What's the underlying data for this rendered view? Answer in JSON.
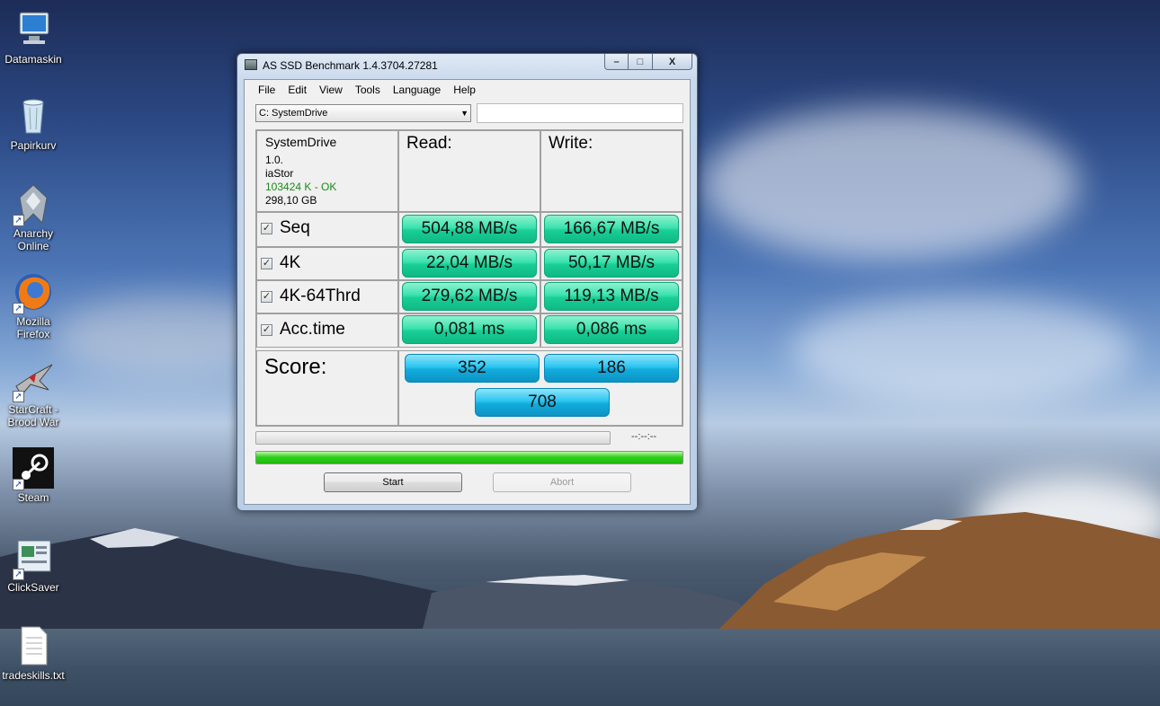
{
  "desktop": {
    "icons": [
      {
        "label": "Datamaskin",
        "icon": "computer-icon",
        "shortcut": false
      },
      {
        "label": "Papirkurv",
        "icon": "recycle-bin-icon",
        "shortcut": false
      },
      {
        "label": "Anarchy Online",
        "icon": "anarchy-online-icon",
        "shortcut": true
      },
      {
        "label": "Mozilla Firefox",
        "icon": "firefox-icon",
        "shortcut": true
      },
      {
        "label": "StarCraft - Brood War",
        "icon": "starcraft-icon",
        "shortcut": true
      },
      {
        "label": "Steam",
        "icon": "steam-icon",
        "shortcut": true
      },
      {
        "label": "ClickSaver",
        "icon": "clicksaver-icon",
        "shortcut": true
      },
      {
        "label": "tradeskills.txt",
        "icon": "text-file-icon",
        "shortcut": false
      }
    ]
  },
  "window": {
    "title": "AS SSD Benchmark 1.4.3704.27281",
    "caption_buttons": {
      "minimize": "–",
      "maximize": "□",
      "close": "X"
    },
    "menu": [
      "File",
      "Edit",
      "View",
      "Tools",
      "Language",
      "Help"
    ],
    "drive_select": {
      "value": "C: SystemDrive",
      "arrow": "▼"
    },
    "drive_info": {
      "name": "SystemDrive",
      "firmware": "1.0.",
      "driver": "iaStor",
      "alignment": "103424 K - OK",
      "size": "298,10 GB",
      "ok_color": "#1a8a1a"
    },
    "headers": {
      "read": "Read:",
      "write": "Write:"
    },
    "rows": [
      {
        "label": "Seq",
        "checked": "✓",
        "read": "504,88 MB/s",
        "write": "166,67 MB/s"
      },
      {
        "label": "4K",
        "checked": "✓",
        "read": "22,04 MB/s",
        "write": "50,17 MB/s"
      },
      {
        "label": "4K-64Thrd",
        "checked": "✓",
        "read": "279,62 MB/s",
        "write": "119,13 MB/s"
      },
      {
        "label": "Acc.time",
        "checked": "✓",
        "read": "0,081 ms",
        "write": "0,086 ms"
      }
    ],
    "score": {
      "label": "Score:",
      "read": "352",
      "write": "186",
      "total": "708"
    },
    "timer": "--:--:--",
    "progress_total": 1.0,
    "buttons": {
      "start": "Start",
      "abort": "Abort"
    },
    "colors": {
      "result": "#1fd29a",
      "score": "#18b4e6",
      "progress": "#2ecc1a"
    }
  }
}
